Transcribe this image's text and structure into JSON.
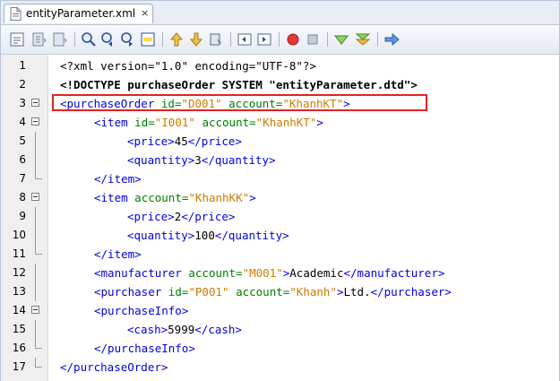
{
  "tab": {
    "title": "entityParameter.xml",
    "close": "×"
  },
  "toolbar": {
    "buttons": [
      "back-icon",
      "source-history-icon",
      "forward-icon",
      "find-icon",
      "find-previous-icon",
      "find-next-icon",
      "toggle-highlight-icon",
      "previous-bookmark-icon",
      "next-bookmark-icon",
      "toggle-bookmark-icon",
      "shift-left-icon",
      "shift-right-icon",
      "record-macro-icon",
      "stop-macro-icon",
      "check-xml-icon",
      "validate-xml-icon",
      "run-xslt-icon"
    ]
  },
  "colors": {
    "tag": "#0000e6",
    "attribute": "#008000",
    "value": "#ce7b00",
    "highlight": "#e32222"
  },
  "lines": [
    {
      "n": "1",
      "text": "<?xml version=\"1.0\" encoding=\"UTF-8\"?>"
    },
    {
      "n": "2",
      "text": "<!DOCTYPE purchaseOrder SYSTEM \"entityParameter.dtd\">"
    },
    {
      "n": "3",
      "tag_open": "<purchaseOrder",
      "a1": "id=",
      "v1": "\"D001\"",
      "a2": "account=",
      "v2": "\"KhanhKT\"",
      "tag_close": ">"
    },
    {
      "n": "4",
      "tag_open": "<item",
      "a1": "id=",
      "v1": "\"I001\"",
      "a2": "account=",
      "v2": "\"KhanhKT\"",
      "tag_close": ">"
    },
    {
      "n": "5",
      "t1": "<price>",
      "text": "45",
      "t2": "</price>"
    },
    {
      "n": "6",
      "t1": "<quantity>",
      "text": "3",
      "t2": "</quantity>"
    },
    {
      "n": "7",
      "t1": "</item>"
    },
    {
      "n": "8",
      "tag_open": "<item",
      "a1": "account=",
      "v1": "\"KhanhKK\"",
      "tag_close": ">"
    },
    {
      "n": "9",
      "t1": "<price>",
      "text": "2",
      "t2": "</price>"
    },
    {
      "n": "10",
      "t1": "<quantity>",
      "text": "100",
      "t2": "</quantity>"
    },
    {
      "n": "11",
      "t1": "</item>"
    },
    {
      "n": "12",
      "tag_open": "<manufacturer",
      "a1": "account=",
      "v1": "\"M001\"",
      "tag_close": ">",
      "text": "Academic",
      "t2": "</manufacturer>"
    },
    {
      "n": "13",
      "tag_open": "<purchaser",
      "a1": "id=",
      "v1": "\"P001\"",
      "a2": "account=",
      "v2": "\"Khanh\"",
      "tag_close": ">",
      "text": "Ltd.",
      "t2": "</purchaser>"
    },
    {
      "n": "14",
      "t1": "<purchaseInfo>"
    },
    {
      "n": "15",
      "t1": "<cash>",
      "text": "5999",
      "t2": "</cash>"
    },
    {
      "n": "16",
      "t1": "</purchaseInfo>"
    },
    {
      "n": "17",
      "t1": "</purchaseOrder>"
    }
  ]
}
